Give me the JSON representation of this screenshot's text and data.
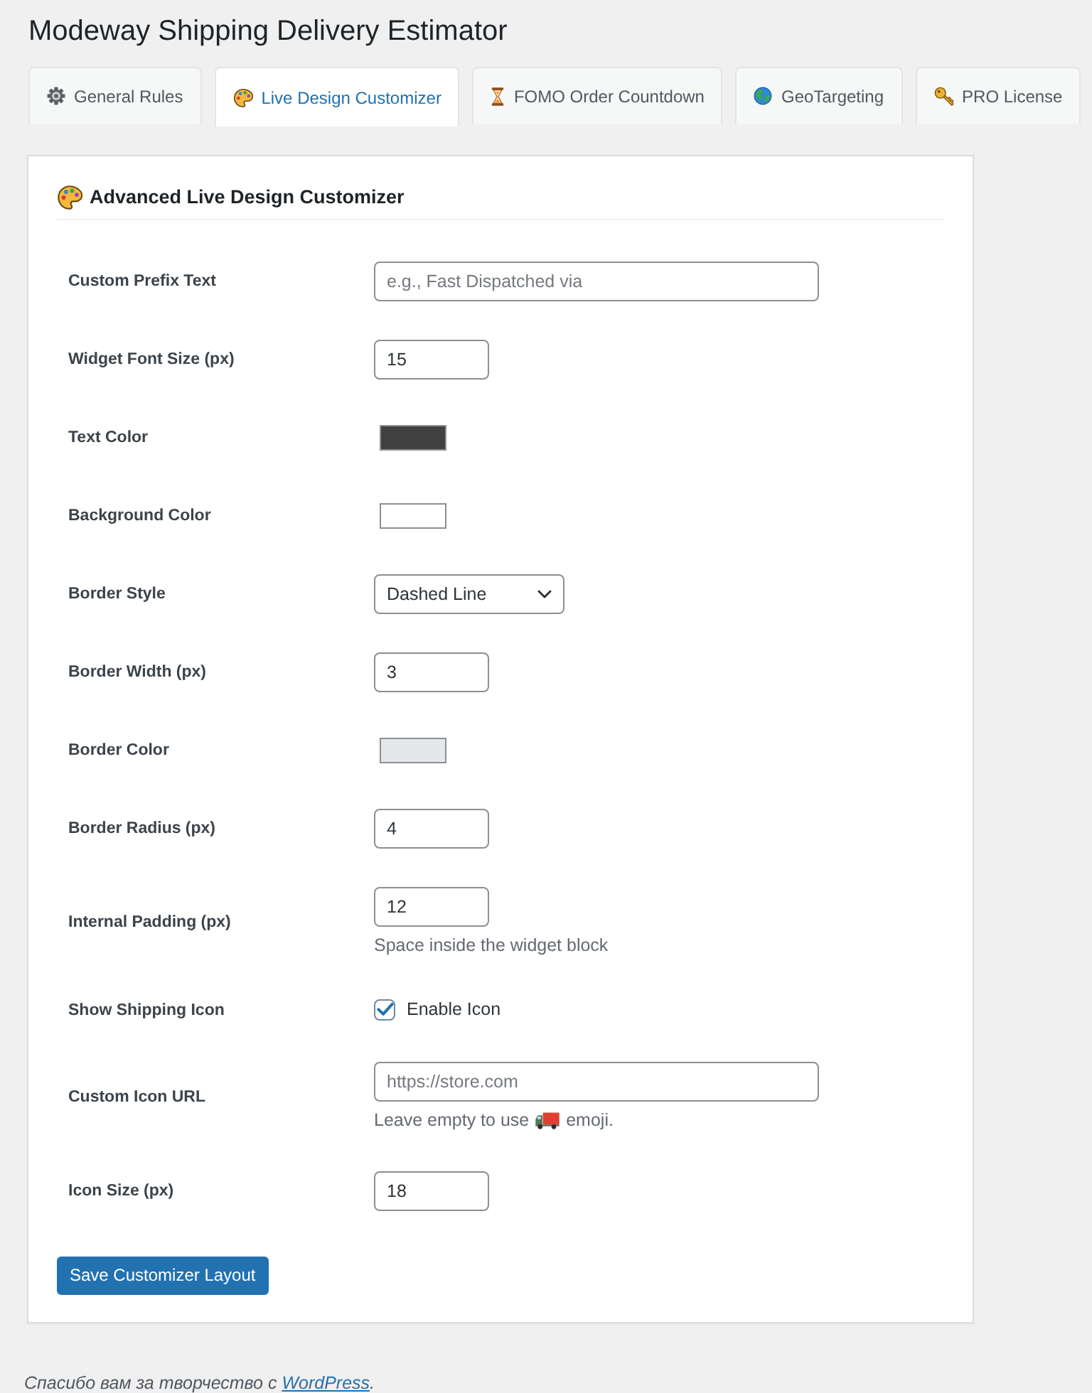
{
  "page": {
    "title": "Modeway Shipping Delivery Estimator"
  },
  "tabs": [
    {
      "label": "General Rules",
      "selected": false
    },
    {
      "label": "Live Design Customizer",
      "selected": true
    },
    {
      "label": "FOMO Order Countdown",
      "selected": false
    },
    {
      "label": "GeoTargeting",
      "selected": false
    },
    {
      "label": "PRO License",
      "selected": false
    }
  ],
  "panel": {
    "heading": "Advanced Live Design Customizer",
    "fields": [
      {
        "kind": "text",
        "label": "Custom Prefix Text",
        "placeholder": "e.g., Fast Dispatched via"
      },
      {
        "kind": "number",
        "label": "Widget Font Size (px)",
        "value": "15"
      },
      {
        "kind": "color",
        "label": "Text Color",
        "color": "#404040"
      },
      {
        "kind": "color",
        "label": "Background Color",
        "color": "#ffffff"
      },
      {
        "kind": "select",
        "label": "Border Style",
        "value": "Dashed Line"
      },
      {
        "kind": "number",
        "label": "Border Width (px)",
        "value": "3"
      },
      {
        "kind": "color",
        "label": "Border Color",
        "color": "#e5e7eb"
      },
      {
        "kind": "number",
        "label": "Border Radius (px)",
        "value": "4"
      },
      {
        "kind": "number",
        "label": "Internal Padding (px)",
        "value": "12",
        "description": [
          "Space inside the widget block"
        ]
      },
      {
        "kind": "checkbox",
        "label": "Show Shipping Icon",
        "checked": true,
        "option": "Enable Icon"
      },
      {
        "kind": "url",
        "label": "Custom Icon URL",
        "placeholder": "https://store.com",
        "description": [
          "Leave empty to use",
          "emoji."
        ]
      },
      {
        "kind": "number",
        "label": "Icon Size (px)",
        "value": "18"
      }
    ],
    "save_button": "Save Customizer Layout"
  },
  "footer": {
    "text": "Спасибо вам за творчество с",
    "link": "WordPress",
    "after_link": "."
  }
}
